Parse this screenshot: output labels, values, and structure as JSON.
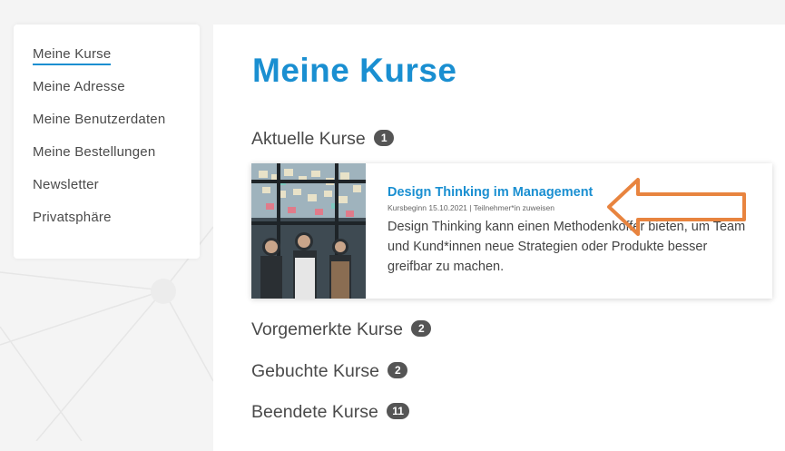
{
  "sidebar": {
    "items": [
      {
        "label": "Meine Kurse",
        "active": true
      },
      {
        "label": "Meine Adresse"
      },
      {
        "label": "Meine Benutzerdaten"
      },
      {
        "label": "Meine Bestellungen"
      },
      {
        "label": "Newsletter"
      },
      {
        "label": "Privatsphäre"
      }
    ]
  },
  "main": {
    "title": "Meine Kurse",
    "sections": {
      "current": {
        "label": "Aktuelle Kurse",
        "count": "1"
      },
      "reserved": {
        "label": "Vorgemerkte Kurse",
        "count": "2"
      },
      "booked": {
        "label": "Gebuchte Kurse",
        "count": "2"
      },
      "finished": {
        "label": "Beendete Kurse",
        "count": "11"
      }
    },
    "course": {
      "title": "Design Thinking im Management",
      "start": "Kursbeginn 15.10.2021",
      "separator": "|",
      "assign_link": "Teilnehmer*in zuweisen",
      "description": "Design Thinking kann einen Methodenkoffer bieten, um Team und Kund*innen neue Strategien oder Produkte besser greifbar zu machen."
    }
  },
  "colors": {
    "accent": "#1a8fd1",
    "badge": "#555555",
    "arrow": "#e8843f",
    "background": "#f4f4f4"
  }
}
